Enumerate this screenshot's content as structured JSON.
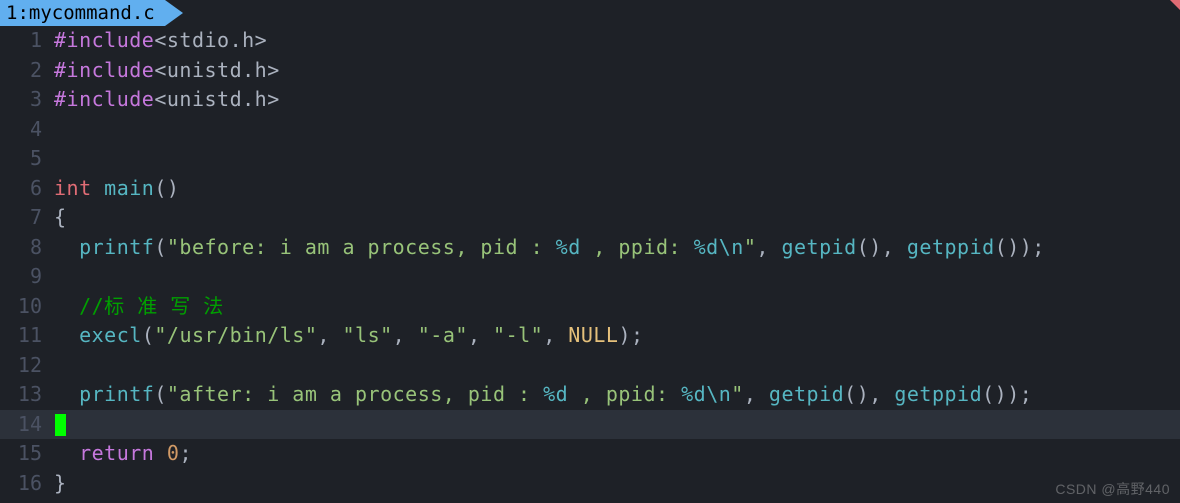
{
  "tab": {
    "index": "1",
    "filename": "mycommand.c"
  },
  "watermark": "CSDN @高野440",
  "gutter": [
    "1",
    "2",
    "3",
    "4",
    "5",
    "6",
    "7",
    "8",
    "9",
    "10",
    "11",
    "12",
    "13",
    "14",
    "15",
    "16"
  ],
  "code": {
    "l1": {
      "pp": "#include",
      "hdr": "<stdio.h>"
    },
    "l2": {
      "pp": "#include",
      "hdr": "<unistd.h>"
    },
    "l3": {
      "pp": "#include",
      "hdr": "<unistd.h>"
    },
    "l6": {
      "type": "int",
      "fn": "main",
      "after": "()"
    },
    "l7": {
      "brace": "{"
    },
    "l8": {
      "indent": "  ",
      "fn1": "printf",
      "p1": "(",
      "s1a": "\"before: i am a process, pid : ",
      "esc1": "%d",
      "s1b": " , ppid: ",
      "esc2": "%d",
      "escn": "\\n",
      "s1c": "\"",
      "c1": ", ",
      "fn2": "getpid",
      "p2": "(), ",
      "fn3": "getppid",
      "p3": "());"
    },
    "l10": {
      "indent": "  ",
      "cmt": "//标 准 写 法"
    },
    "l11": {
      "indent": "  ",
      "fn": "execl",
      "p1": "(",
      "s1": "\"/usr/bin/ls\"",
      "c1": ", ",
      "s2": "\"ls\"",
      "c2": ", ",
      "s3": "\"-a\"",
      "c3": ", ",
      "s4": "\"-l\"",
      "c4": ", ",
      "null": "NULL",
      "p2": ");"
    },
    "l13": {
      "indent": "  ",
      "fn1": "printf",
      "p1": "(",
      "s1a": "\"after: i am a process, pid : ",
      "esc1": "%d",
      "s1b": " , ppid: ",
      "esc2": "%d",
      "escn": "\\n",
      "s1c": "\"",
      "c1": ", ",
      "fn2": "getpid",
      "p2": "(), ",
      "fn3": "getppid",
      "p3": "());"
    },
    "l15": {
      "indent": "  ",
      "ret": "return",
      "sp": " ",
      "num": "0",
      "semi": ";"
    },
    "l16": {
      "brace": "}"
    }
  }
}
